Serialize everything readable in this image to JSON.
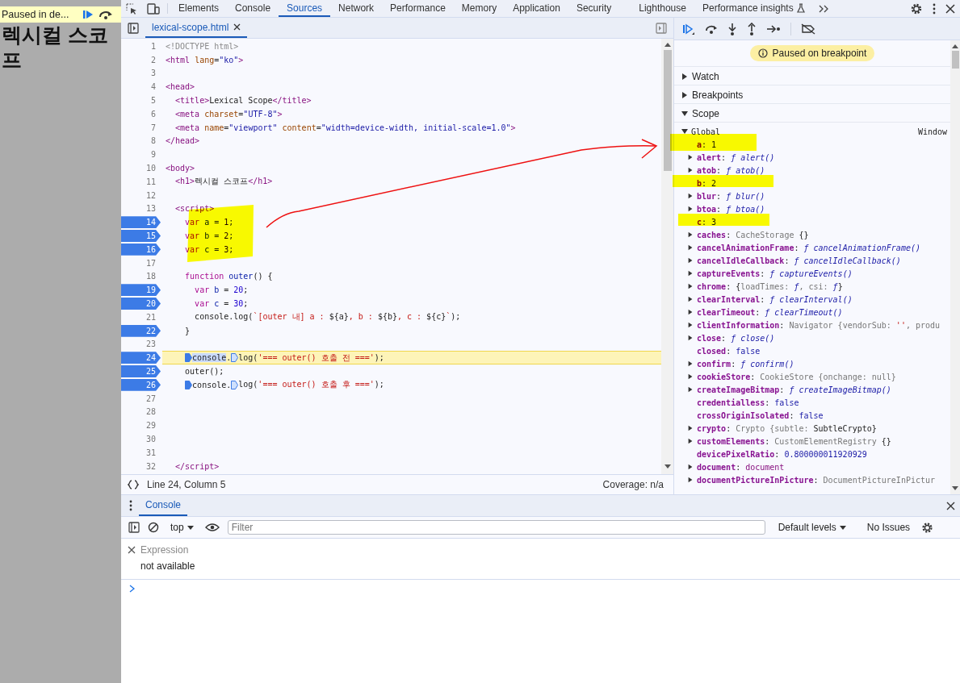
{
  "page": {
    "heading": "렉시컬 스코프",
    "paused_bar": {
      "label": "Paused in de..."
    }
  },
  "tabs": [
    {
      "label": "Elements",
      "selected": false,
      "experimental": false
    },
    {
      "label": "Console",
      "selected": false,
      "experimental": false
    },
    {
      "label": "Sources",
      "selected": true,
      "experimental": false
    },
    {
      "label": "Network",
      "selected": false,
      "experimental": false
    },
    {
      "label": "Performance",
      "selected": false,
      "experimental": false
    },
    {
      "label": "Memory",
      "selected": false,
      "experimental": false
    },
    {
      "label": "Application",
      "selected": false,
      "experimental": false
    },
    {
      "label": "Security",
      "selected": false,
      "experimental": false
    },
    {
      "label": "Lighthouse",
      "selected": false,
      "experimental": false
    },
    {
      "label": "Performance insights",
      "selected": false,
      "experimental": true
    }
  ],
  "editor": {
    "file_tab": {
      "label": "lexical-scope.html",
      "selected": true
    },
    "lines": [
      {
        "number": "1",
        "breakpoint": false,
        "current": false,
        "code": [
          {
            "kind": "comment",
            "t": "<!DOCTYPE html>"
          }
        ]
      },
      {
        "number": "2",
        "breakpoint": false,
        "current": false,
        "code": [
          {
            "kind": "tag",
            "t": "<html"
          },
          {
            "kind": "attribute",
            "t": " lang"
          },
          {
            "kind": "plain",
            "t": "="
          },
          {
            "kind": "string",
            "t": "\"ko\""
          },
          {
            "kind": "tag",
            "t": ">"
          }
        ]
      },
      {
        "number": "3",
        "breakpoint": false,
        "current": false
      },
      {
        "number": "4",
        "breakpoint": false,
        "current": false,
        "code": [
          {
            "kind": "tag",
            "t": "<head>"
          }
        ]
      },
      {
        "number": "5",
        "breakpoint": false,
        "current": false,
        "code": [
          {
            "kind": "tag",
            "t": "  <title>"
          },
          {
            "kind": "plain",
            "t": "Lexical Scope"
          },
          {
            "kind": "tag",
            "t": "</title>"
          }
        ]
      },
      {
        "number": "6",
        "breakpoint": false,
        "current": false,
        "code": [
          {
            "kind": "tag",
            "t": "  <meta"
          },
          {
            "kind": "attribute",
            "t": " charset"
          },
          {
            "kind": "plain",
            "t": "="
          },
          {
            "kind": "string",
            "t": "\"UTF-8\""
          },
          {
            "kind": "tag",
            "t": ">"
          }
        ]
      },
      {
        "number": "7",
        "breakpoint": false,
        "current": false,
        "code": [
          {
            "kind": "tag",
            "t": "  <meta"
          },
          {
            "kind": "attribute",
            "t": " name"
          },
          {
            "kind": "plain",
            "t": "="
          },
          {
            "kind": "string",
            "t": "\"viewport\""
          },
          {
            "kind": "attribute",
            "t": " content"
          },
          {
            "kind": "plain",
            "t": "="
          },
          {
            "kind": "string",
            "t": "\"width=device-width, initial-scale=1.0\""
          },
          {
            "kind": "tag",
            "t": ">"
          }
        ]
      },
      {
        "number": "8",
        "breakpoint": false,
        "current": false,
        "code": [
          {
            "kind": "tag",
            "t": "</head>"
          }
        ]
      },
      {
        "number": "9",
        "breakpoint": false,
        "current": false
      },
      {
        "number": "10",
        "breakpoint": false,
        "current": false,
        "code": [
          {
            "kind": "tag",
            "t": "<body>"
          }
        ]
      },
      {
        "number": "11",
        "breakpoint": false,
        "current": false,
        "code": [
          {
            "kind": "tag",
            "t": "  <h1>"
          },
          {
            "kind": "plain",
            "t": "렉시컬 스코프"
          },
          {
            "kind": "tag",
            "t": "</h1>"
          }
        ]
      },
      {
        "number": "12",
        "breakpoint": false,
        "current": false
      },
      {
        "number": "13",
        "breakpoint": false,
        "current": false,
        "code": [
          {
            "kind": "tag",
            "t": "  <script>"
          }
        ]
      },
      {
        "number": "14",
        "breakpoint": true,
        "current": false,
        "code": [
          {
            "kind": "keyword",
            "t": "    var"
          },
          {
            "kind": "variable",
            "t": " a"
          },
          {
            "kind": "plain",
            "t": " = "
          },
          {
            "kind": "number",
            "t": "1"
          },
          {
            "kind": "plain",
            "t": ";"
          }
        ]
      },
      {
        "number": "15",
        "breakpoint": true,
        "current": false,
        "code": [
          {
            "kind": "keyword",
            "t": "    var"
          },
          {
            "kind": "variable",
            "t": " b"
          },
          {
            "kind": "plain",
            "t": " = "
          },
          {
            "kind": "number",
            "t": "2"
          },
          {
            "kind": "plain",
            "t": ";"
          }
        ]
      },
      {
        "number": "16",
        "breakpoint": true,
        "current": false,
        "code": [
          {
            "kind": "keyword",
            "t": "    var"
          },
          {
            "kind": "variable",
            "t": " c"
          },
          {
            "kind": "plain",
            "t": " = "
          },
          {
            "kind": "number",
            "t": "3"
          },
          {
            "kind": "plain",
            "t": ";"
          }
        ]
      },
      {
        "number": "17",
        "breakpoint": false,
        "current": false
      },
      {
        "number": "18",
        "breakpoint": false,
        "current": false,
        "code": [
          {
            "kind": "keyword",
            "t": "    function"
          },
          {
            "kind": "variable",
            "t": " outer"
          },
          {
            "kind": "plain",
            "t": "() {"
          }
        ]
      },
      {
        "number": "19",
        "breakpoint": true,
        "current": false,
        "code": [
          {
            "kind": "keyword",
            "t": "      var"
          },
          {
            "kind": "variable",
            "t": " b"
          },
          {
            "kind": "plain",
            "t": " = "
          },
          {
            "kind": "number",
            "t": "20"
          },
          {
            "kind": "plain",
            "t": ";"
          }
        ]
      },
      {
        "number": "20",
        "breakpoint": true,
        "current": false,
        "code": [
          {
            "kind": "keyword",
            "t": "      var"
          },
          {
            "kind": "variable",
            "t": " c"
          },
          {
            "kind": "plain",
            "t": " = "
          },
          {
            "kind": "number",
            "t": "30"
          },
          {
            "kind": "plain",
            "t": ";"
          }
        ]
      },
      {
        "number": "21",
        "breakpoint": false,
        "current": false,
        "code": [
          {
            "kind": "plain",
            "t": "      console.log("
          },
          {
            "kind": "template",
            "t": "`[outer 내] a : "
          },
          {
            "kind": "plain",
            "t": "${a}"
          },
          {
            "kind": "template",
            "t": ", b : "
          },
          {
            "kind": "plain",
            "t": "${b}"
          },
          {
            "kind": "template",
            "t": ", c : "
          },
          {
            "kind": "plain",
            "t": "${c}"
          },
          {
            "kind": "template",
            "t": "`"
          },
          {
            "kind": "plain",
            "t": ");"
          }
        ]
      },
      {
        "number": "22",
        "breakpoint": true,
        "current": false,
        "code": [
          {
            "kind": "plain",
            "t": "    }"
          }
        ]
      },
      {
        "number": "23",
        "breakpoint": false,
        "current": false
      },
      {
        "number": "24",
        "breakpoint": true,
        "current": true,
        "code": [
          {
            "kind": "selected",
            "t": "    console",
            "marker_active": true
          },
          {
            "kind": "plain",
            "t": "."
          },
          {
            "kind": "plain",
            "t": "log(",
            "marker_active": false
          },
          {
            "kind": "template",
            "t": "'=== outer() 호출 전 ==='"
          },
          {
            "kind": "plain",
            "t": ");"
          }
        ]
      },
      {
        "number": "25",
        "breakpoint": true,
        "current": false,
        "code": [
          {
            "kind": "plain",
            "t": "    outer();"
          }
        ]
      },
      {
        "number": "26",
        "breakpoint": true,
        "current": false,
        "code": [
          {
            "kind": "plain",
            "t": "    console.",
            "marker_active": true
          },
          {
            "kind": "plain",
            "t": "log(",
            "marker_active": false
          },
          {
            "kind": "template",
            "t": "'=== outer() 호출 후 ==='"
          },
          {
            "kind": "plain",
            "t": ");"
          }
        ]
      },
      {
        "number": "27",
        "breakpoint": false,
        "current": false
      },
      {
        "number": "28",
        "breakpoint": false,
        "current": false
      },
      {
        "number": "29",
        "breakpoint": false,
        "current": false
      },
      {
        "number": "30",
        "breakpoint": false,
        "current": false
      },
      {
        "number": "31",
        "breakpoint": false,
        "current": false
      },
      {
        "number": "32",
        "breakpoint": false,
        "current": false,
        "code": [
          {
            "kind": "tag",
            "t": "  </script>"
          }
        ]
      }
    ],
    "status": {
      "position": "Line 24, Column 5",
      "coverage": "Coverage: n/a"
    }
  },
  "debugger": {
    "status": "Paused on breakpoint",
    "sections": [
      {
        "label": "Watch",
        "expanded": false
      },
      {
        "label": "Breakpoints",
        "expanded": false
      },
      {
        "label": "Scope",
        "expanded": true
      }
    ],
    "scope": {
      "label": "Global",
      "value": "Window",
      "expanded": true,
      "properties": [
        {
          "name": "a",
          "expandable": false,
          "value": [
            {
              "kind": "plain",
              "t": ": "
            },
            {
              "kind": "number",
              "t": "1"
            }
          ]
        },
        {
          "name": "alert",
          "expandable": true,
          "value": [
            {
              "kind": "plain",
              "t": ": "
            },
            {
              "kind": "function",
              "t": "ƒ alert()"
            }
          ]
        },
        {
          "name": "atob",
          "expandable": true,
          "value": [
            {
              "kind": "plain",
              "t": ": "
            },
            {
              "kind": "function",
              "t": "ƒ atob()"
            }
          ]
        },
        {
          "name": "b",
          "expandable": false,
          "value": [
            {
              "kind": "plain",
              "t": ": "
            },
            {
              "kind": "number",
              "t": "2"
            }
          ]
        },
        {
          "name": "blur",
          "expandable": true,
          "value": [
            {
              "kind": "plain",
              "t": ": "
            },
            {
              "kind": "function",
              "t": "ƒ blur()"
            }
          ]
        },
        {
          "name": "btoa",
          "expandable": true,
          "value": [
            {
              "kind": "plain",
              "t": ": "
            },
            {
              "kind": "function",
              "t": "ƒ btoa()"
            }
          ]
        },
        {
          "name": "c",
          "expandable": false,
          "value": [
            {
              "kind": "plain",
              "t": ": "
            },
            {
              "kind": "number",
              "t": "3"
            }
          ]
        },
        {
          "name": "caches",
          "expandable": true,
          "value": [
            {
              "kind": "plain",
              "t": ": "
            },
            {
              "kind": "gray",
              "t": "CacheStorage"
            },
            {
              "kind": "plain",
              "t": " {}"
            }
          ]
        },
        {
          "name": "cancelAnimationFrame",
          "expandable": true,
          "value": [
            {
              "kind": "plain",
              "t": ": "
            },
            {
              "kind": "function",
              "t": "ƒ cancelAnimationFrame()"
            }
          ]
        },
        {
          "name": "cancelIdleCallback",
          "expandable": true,
          "value": [
            {
              "kind": "plain",
              "t": ": "
            },
            {
              "kind": "function",
              "t": "ƒ cancelIdleCallback()"
            }
          ]
        },
        {
          "name": "captureEvents",
          "expandable": true,
          "value": [
            {
              "kind": "plain",
              "t": ": "
            },
            {
              "kind": "function",
              "t": "ƒ captureEvents()"
            }
          ]
        },
        {
          "name": "chrome",
          "expandable": true,
          "value": [
            {
              "kind": "plain",
              "t": ": {"
            },
            {
              "kind": "gray",
              "t": "loadTimes: "
            },
            {
              "kind": "function",
              "t": "ƒ"
            },
            {
              "kind": "gray",
              "t": ", csi: "
            },
            {
              "kind": "function",
              "t": "ƒ"
            },
            {
              "kind": "plain",
              "t": "}"
            }
          ]
        },
        {
          "name": "clearInterval",
          "expandable": true,
          "value": [
            {
              "kind": "plain",
              "t": ": "
            },
            {
              "kind": "function",
              "t": "ƒ clearInterval()"
            }
          ]
        },
        {
          "name": "clearTimeout",
          "expandable": true,
          "value": [
            {
              "kind": "plain",
              "t": ": "
            },
            {
              "kind": "function",
              "t": "ƒ clearTimeout()"
            }
          ]
        },
        {
          "name": "clientInformation",
          "expandable": true,
          "value": [
            {
              "kind": "plain",
              "t": ": "
            },
            {
              "kind": "gray",
              "t": "Navigator {vendorSub: "
            },
            {
              "kind": "string",
              "t": "''"
            },
            {
              "kind": "gray",
              "t": ", produ"
            }
          ]
        },
        {
          "name": "close",
          "expandable": true,
          "value": [
            {
              "kind": "plain",
              "t": ": "
            },
            {
              "kind": "function",
              "t": "ƒ close()"
            }
          ]
        },
        {
          "name": "closed",
          "expandable": false,
          "value": [
            {
              "kind": "plain",
              "t": ": "
            },
            {
              "kind": "number",
              "t": "false"
            }
          ]
        },
        {
          "name": "confirm",
          "expandable": true,
          "value": [
            {
              "kind": "plain",
              "t": ": "
            },
            {
              "kind": "function",
              "t": "ƒ confirm()"
            }
          ]
        },
        {
          "name": "cookieStore",
          "expandable": true,
          "value": [
            {
              "kind": "plain",
              "t": ": "
            },
            {
              "kind": "gray",
              "t": "CookieStore {onchange: null}"
            }
          ]
        },
        {
          "name": "createImageBitmap",
          "expandable": true,
          "value": [
            {
              "kind": "plain",
              "t": ": "
            },
            {
              "kind": "function",
              "t": "ƒ createImageBitmap()"
            }
          ]
        },
        {
          "name": "credentialless",
          "expandable": false,
          "value": [
            {
              "kind": "plain",
              "t": ": "
            },
            {
              "kind": "number",
              "t": "false"
            }
          ]
        },
        {
          "name": "crossOriginIsolated",
          "expandable": false,
          "value": [
            {
              "kind": "plain",
              "t": ": "
            },
            {
              "kind": "number",
              "t": "false"
            }
          ]
        },
        {
          "name": "crypto",
          "expandable": true,
          "value": [
            {
              "kind": "plain",
              "t": ": "
            },
            {
              "kind": "gray",
              "t": "Crypto {subtle: "
            },
            {
              "kind": "plain",
              "t": "SubtleCrypto}"
            }
          ]
        },
        {
          "name": "customElements",
          "expandable": true,
          "value": [
            {
              "kind": "plain",
              "t": ": "
            },
            {
              "kind": "gray",
              "t": "CustomElementRegistry"
            },
            {
              "kind": "plain",
              "t": " {}"
            }
          ]
        },
        {
          "name": "devicePixelRatio",
          "expandable": false,
          "value": [
            {
              "kind": "plain",
              "t": ": "
            },
            {
              "kind": "number",
              "t": "0.800000011920929"
            }
          ]
        },
        {
          "name": "document",
          "expandable": true,
          "value": [
            {
              "kind": "plain",
              "t": ": "
            },
            {
              "kind": "node",
              "t": "document"
            }
          ]
        },
        {
          "name": "documentPictureInPicture",
          "expandable": true,
          "value": [
            {
              "kind": "plain",
              "t": ": "
            },
            {
              "kind": "gray",
              "t": "DocumentPictureInPictur"
            }
          ]
        }
      ]
    }
  },
  "drawer": {
    "tabs": [
      {
        "label": "Console",
        "selected": true
      }
    ],
    "context": "top",
    "filter": {
      "placeholder": "Filter"
    },
    "levels": "Default levels",
    "issues": "No Issues",
    "expression": {
      "placeholder": "Expression",
      "result": "not available"
    }
  }
}
